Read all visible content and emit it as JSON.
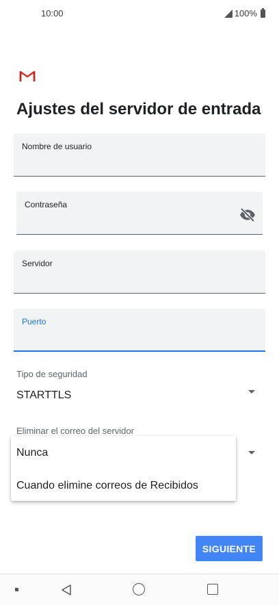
{
  "status_bar": {
    "time": "10:00",
    "battery": "100%"
  },
  "header": {
    "logo": "gmail-logo",
    "title": "Ajustes del servidor de entrada"
  },
  "form": {
    "username": {
      "label": "Nombre de usuario",
      "value": ""
    },
    "password": {
      "label": "Contraseña",
      "value": "",
      "toggle_icon": "visibility-off-icon"
    },
    "server": {
      "label": "Servidor",
      "value": ""
    },
    "port": {
      "label": "Puerto",
      "value": "",
      "focused": true
    },
    "security": {
      "label": "Tipo de seguridad",
      "value": "STARTTLS"
    },
    "delete_policy": {
      "label": "Eliminar el correo del servidor",
      "options": [
        "Nunca",
        "Cuando elimine correos de Recibidos"
      ]
    }
  },
  "actions": {
    "next_label": "SIGUIENTE"
  },
  "colors": {
    "accent": "#1a73e8",
    "button": "#4285f4",
    "field_bg": "#f1f3f4"
  },
  "nav_bar": {
    "icons": [
      "menu-dot-icon",
      "back-icon",
      "home-icon",
      "recents-icon"
    ]
  }
}
